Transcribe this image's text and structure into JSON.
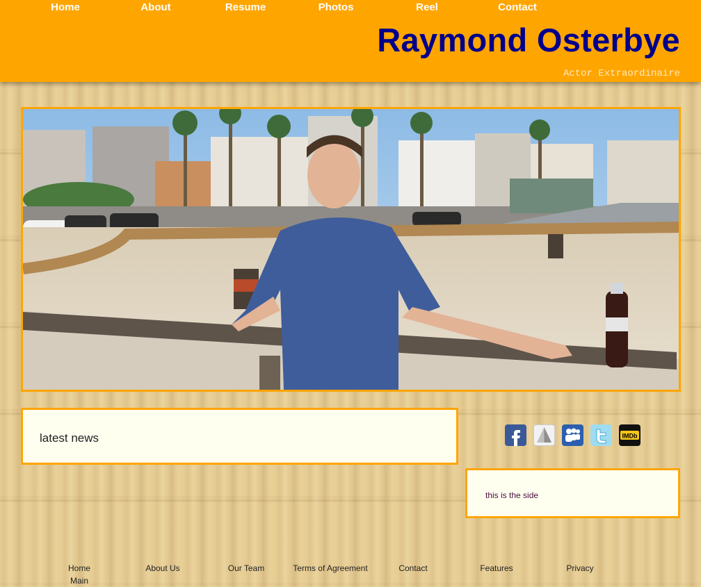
{
  "nav": {
    "items": [
      {
        "label": "Home"
      },
      {
        "label": "About"
      },
      {
        "label": "Resume"
      },
      {
        "label": "Photos"
      },
      {
        "label": "Reel"
      },
      {
        "label": "Contact"
      }
    ]
  },
  "header": {
    "title": "Raymond Osterbye",
    "tagline": "Actor Extraordinaire"
  },
  "colors": {
    "header_bg": "#ffa500",
    "title": "#00008b",
    "box_border": "#ffa500",
    "box_bg": "#fffff0"
  },
  "main": {
    "news_heading": "latest news"
  },
  "social": {
    "icons": [
      "facebook-icon",
      "pyramid-icon",
      "myspace-icon",
      "twitter-icon",
      "imdb-icon"
    ],
    "imdb_label": "IMDb"
  },
  "sidebar": {
    "text": "this is the side"
  },
  "footer": {
    "items": [
      {
        "label": "Home",
        "sub": "Main"
      },
      {
        "label": "About Us"
      },
      {
        "label": "Our Team"
      },
      {
        "label": "Terms of Agreement"
      },
      {
        "label": "Contact"
      },
      {
        "label": "Features"
      },
      {
        "label": "Privacy"
      }
    ]
  }
}
